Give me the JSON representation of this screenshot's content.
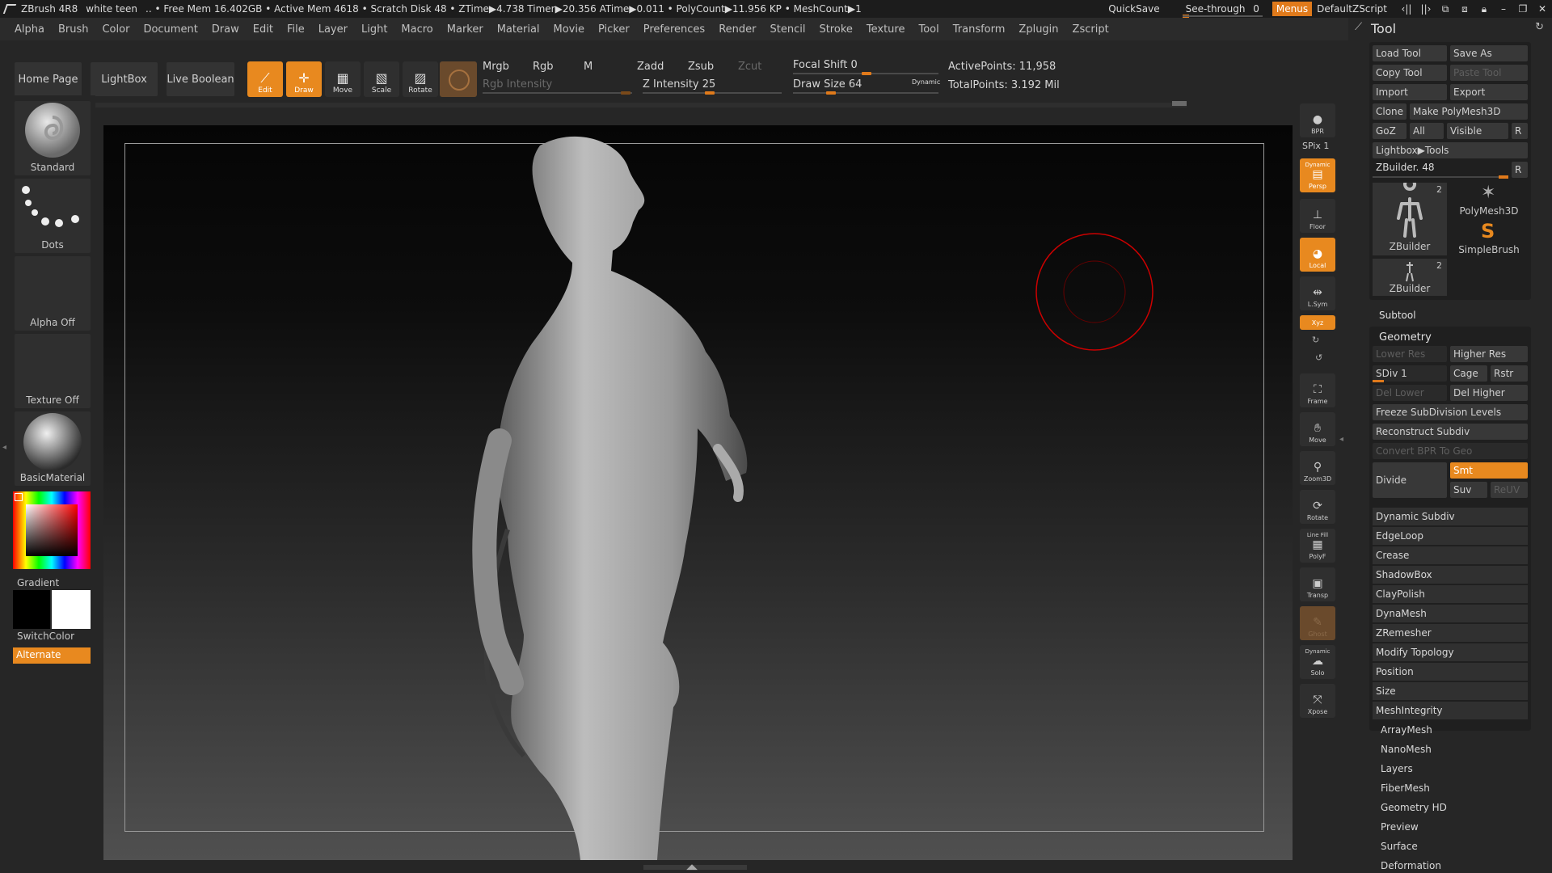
{
  "titlebar": {
    "app": "ZBrush 4R8",
    "document": "white teen",
    "stats": ".. • Free Mem 16.402GB • Active Mem 4618 • Scratch Disk 48 • ZTime▶4.738 Timer▶20.356 ATime▶0.011 • PolyCount▶11.956 KP • MeshCount▶1",
    "quicksave": "QuickSave",
    "seethrough_label": "See-through",
    "seethrough_value": "0",
    "menus": "Menus",
    "script": "DefaultZScript"
  },
  "menubar": [
    "Alpha",
    "Brush",
    "Color",
    "Document",
    "Draw",
    "Edit",
    "File",
    "Layer",
    "Light",
    "Macro",
    "Marker",
    "Material",
    "Movie",
    "Picker",
    "Preferences",
    "Render",
    "Stencil",
    "Stroke",
    "Texture",
    "Tool",
    "Transform",
    "Zplugin",
    "Zscript"
  ],
  "shelf": {
    "home_page": "Home Page",
    "lightbox": "LightBox",
    "live_boolean": "Live Boolean",
    "edit": "Edit",
    "draw": "Draw",
    "move": "Move",
    "scale": "Scale",
    "rotate": "Rotate",
    "mrgb": "Mrgb",
    "rgb": "Rgb",
    "m": "M",
    "rgb_intensity": "Rgb Intensity",
    "zadd": "Zadd",
    "zsub": "Zsub",
    "zcut": "Zcut",
    "z_intensity": "Z Intensity 25",
    "focal_shift": "Focal Shift 0",
    "draw_size": "Draw Size 64",
    "dynamic": "Dynamic",
    "active_points": "ActivePoints: 11,958",
    "total_points": "TotalPoints: 3.192 Mil"
  },
  "left": {
    "brush": "Standard",
    "stroke": "Dots",
    "alpha": "Alpha Off",
    "texture": "Texture Off",
    "material": "BasicMaterial",
    "gradient": "Gradient",
    "switchcolor": "SwitchColor",
    "alternate": "Alternate"
  },
  "rightshelf": {
    "bpr": "BPR",
    "spix": "SPix 1",
    "dynamic": "Dynamic",
    "persp": "Persp",
    "floor": "Floor",
    "local": "Local",
    "lsym": "L.Sym",
    "xyz": "Xyz",
    "frame": "Frame",
    "move": "Move",
    "zoom3d": "Zoom3D",
    "rotate": "Rotate",
    "linefill": "Line Fill",
    "polyf": "PolyF",
    "transp": "Transp",
    "ghost": "Ghost",
    "dynamic2": "Dynamic",
    "solo": "Solo",
    "xpose": "Xpose"
  },
  "tool": {
    "title": "Tool",
    "load_tool": "Load Tool",
    "save_as": "Save As",
    "copy_tool": "Copy Tool",
    "paste_tool": "Paste Tool",
    "import": "Import",
    "export": "Export",
    "clone": "Clone",
    "make_polymesh": "Make PolyMesh3D",
    "goz": "GoZ",
    "all": "All",
    "visible": "Visible",
    "r": "R",
    "lightbox_tools": "Lightbox▶Tools",
    "zbuilder_slider": "ZBuilder. 48",
    "thumb1_label": "ZBuilder",
    "thumb1_count": "2",
    "thumb2_label": "PolyMesh3D",
    "thumb3_label": "SimpleBrush",
    "thumb4_label": "ZBuilder",
    "thumb4_count": "2",
    "subtool": "Subtool",
    "geometry": "Geometry",
    "lower_res": "Lower Res",
    "higher_res": "Higher Res",
    "sdiv": "SDiv 1",
    "cage": "Cage",
    "rstr": "Rstr",
    "del_lower": "Del Lower",
    "del_higher": "Del Higher",
    "freeze": "Freeze SubDivision Levels",
    "reconstruct": "Reconstruct Subdiv",
    "convert_bpr": "Convert BPR To Geo",
    "divide": "Divide",
    "smt": "Smt",
    "suv": "Suv",
    "reuv": "ReUV",
    "geo_items": [
      "Dynamic Subdiv",
      "EdgeLoop",
      "Crease",
      "ShadowBox",
      "ClayPolish",
      "DynaMesh",
      "ZRemesher",
      "Modify Topology",
      "Position",
      "Size",
      "MeshIntegrity"
    ],
    "sections": [
      "ArrayMesh",
      "NanoMesh",
      "Layers",
      "FiberMesh",
      "Geometry HD",
      "Preview",
      "Surface",
      "Deformation"
    ]
  }
}
